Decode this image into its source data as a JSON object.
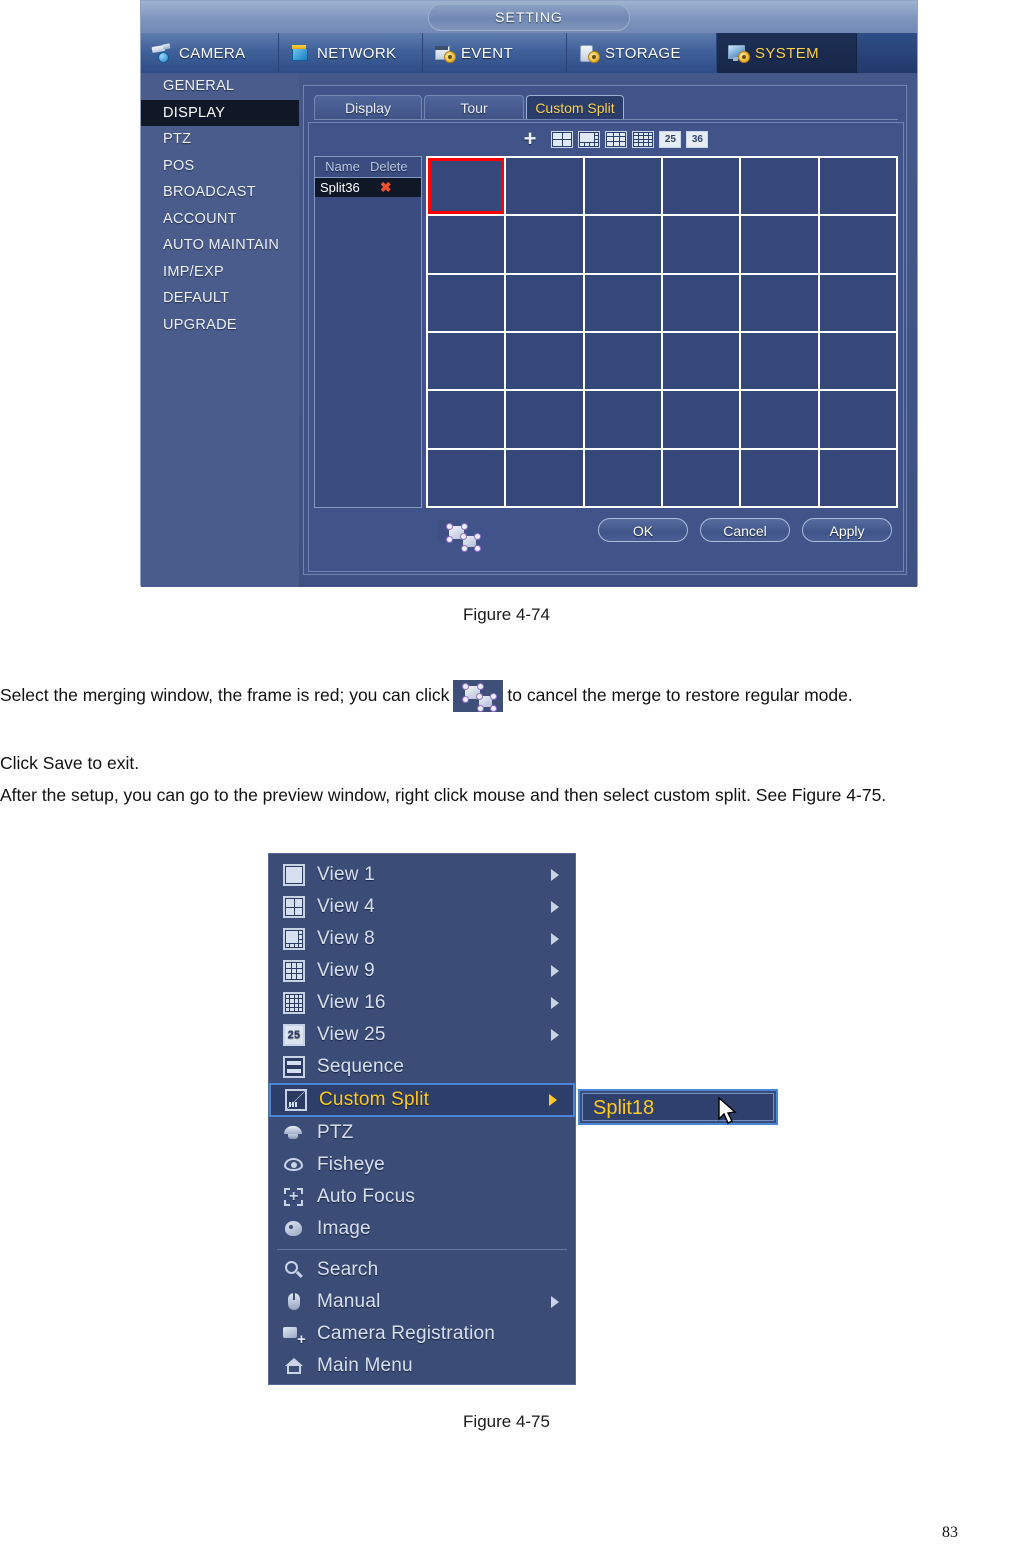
{
  "figure_474": {
    "window_title": "SETTING",
    "main_tabs": [
      {
        "label": "CAMERA",
        "icon": "camera-icon",
        "active": false
      },
      {
        "label": "NETWORK",
        "icon": "network-icon",
        "active": false
      },
      {
        "label": "EVENT",
        "icon": "event-icon",
        "active": false
      },
      {
        "label": "STORAGE",
        "icon": "storage-icon",
        "active": false
      },
      {
        "label": "SYSTEM",
        "icon": "system-icon",
        "active": true
      }
    ],
    "sidebar": [
      {
        "label": "GENERAL",
        "active": false
      },
      {
        "label": "DISPLAY",
        "active": true
      },
      {
        "label": "PTZ",
        "active": false
      },
      {
        "label": "POS",
        "active": false
      },
      {
        "label": "BROADCAST",
        "active": false
      },
      {
        "label": "ACCOUNT",
        "active": false
      },
      {
        "label": "AUTO MAINTAIN",
        "active": false
      },
      {
        "label": "IMP/EXP",
        "active": false
      },
      {
        "label": "DEFAULT",
        "active": false
      },
      {
        "label": "UPGRADE",
        "active": false
      }
    ],
    "sub_tabs": [
      {
        "label": "Display",
        "active": false
      },
      {
        "label": "Tour",
        "active": false
      },
      {
        "label": "Custom Split",
        "active": true
      }
    ],
    "toolbar": {
      "add_label": "+",
      "split_icons": [
        "split-4-icon",
        "split-8-icon",
        "split-9-icon",
        "split-16-icon",
        "split-25-icon",
        "split-36-icon"
      ],
      "split_25_label": "25",
      "split_36_label": "36"
    },
    "name_table": {
      "headers": [
        "Name",
        "Delete"
      ],
      "rows": [
        {
          "name": "Split36",
          "delete": "✖"
        }
      ]
    },
    "grid": {
      "rows": 6,
      "columns": 6,
      "total_cells": 36,
      "selected_cell_index": 0,
      "selection_color": "#ff0000"
    },
    "merge_icon": "merge-windows-icon",
    "buttons": [
      {
        "label": "OK"
      },
      {
        "label": "Cancel"
      },
      {
        "label": "Apply"
      }
    ],
    "accent_color": "#ffd24a"
  },
  "captions": {
    "fig_474": "Figure 4-74",
    "fig_475": "Figure 4-75"
  },
  "body_text": {
    "p1_before": "Select the merging window, the frame is red; you can click",
    "p1_after": "to cancel the merge to restore regular mode.",
    "p2": "Click Save to exit.",
    "p3": "After the setup, you can go to the preview window, right click mouse and then select custom split. See Figure 4-75."
  },
  "figure_475": {
    "menu_items": [
      {
        "label": "View 1",
        "icon": "view-1-icon",
        "arrow": true,
        "highlight": false
      },
      {
        "label": "View 4",
        "icon": "view-4-icon",
        "arrow": true,
        "highlight": false
      },
      {
        "label": "View 8",
        "icon": "view-8-icon",
        "arrow": true,
        "highlight": false
      },
      {
        "label": "View 9",
        "icon": "view-9-icon",
        "arrow": true,
        "highlight": false
      },
      {
        "label": "View 16",
        "icon": "view-16-icon",
        "arrow": true,
        "highlight": false
      },
      {
        "label": "View 25",
        "icon": "view-25-icon",
        "arrow": true,
        "highlight": false
      },
      {
        "label": "Sequence",
        "icon": "sequence-icon",
        "arrow": false,
        "highlight": false
      },
      {
        "label": "Custom Split",
        "icon": "custom-split-icon",
        "arrow": true,
        "highlight": true
      },
      {
        "label": "PTZ",
        "icon": "ptz-icon",
        "arrow": false,
        "highlight": false
      },
      {
        "label": "Fisheye",
        "icon": "fisheye-icon",
        "arrow": false,
        "highlight": false
      },
      {
        "label": "Auto Focus",
        "icon": "auto-focus-icon",
        "arrow": false,
        "highlight": false
      },
      {
        "label": "Image",
        "icon": "image-icon",
        "arrow": false,
        "highlight": false
      },
      {
        "label": "Search",
        "icon": "search-icon",
        "arrow": false,
        "highlight": false
      },
      {
        "label": "Manual",
        "icon": "manual-icon",
        "arrow": true,
        "highlight": false
      },
      {
        "label": "Camera Registration",
        "icon": "camera-registration-icon",
        "arrow": false,
        "highlight": false
      },
      {
        "label": "Main Menu",
        "icon": "main-menu-icon",
        "arrow": false,
        "highlight": false
      }
    ],
    "separator_after_index": 11,
    "view_25_icon_label": "25",
    "submenu": {
      "label": "Split18"
    },
    "cursor": "mouse-pointer-icon",
    "highlight_color": "#ffc91e"
  },
  "page": {
    "number": "83"
  }
}
